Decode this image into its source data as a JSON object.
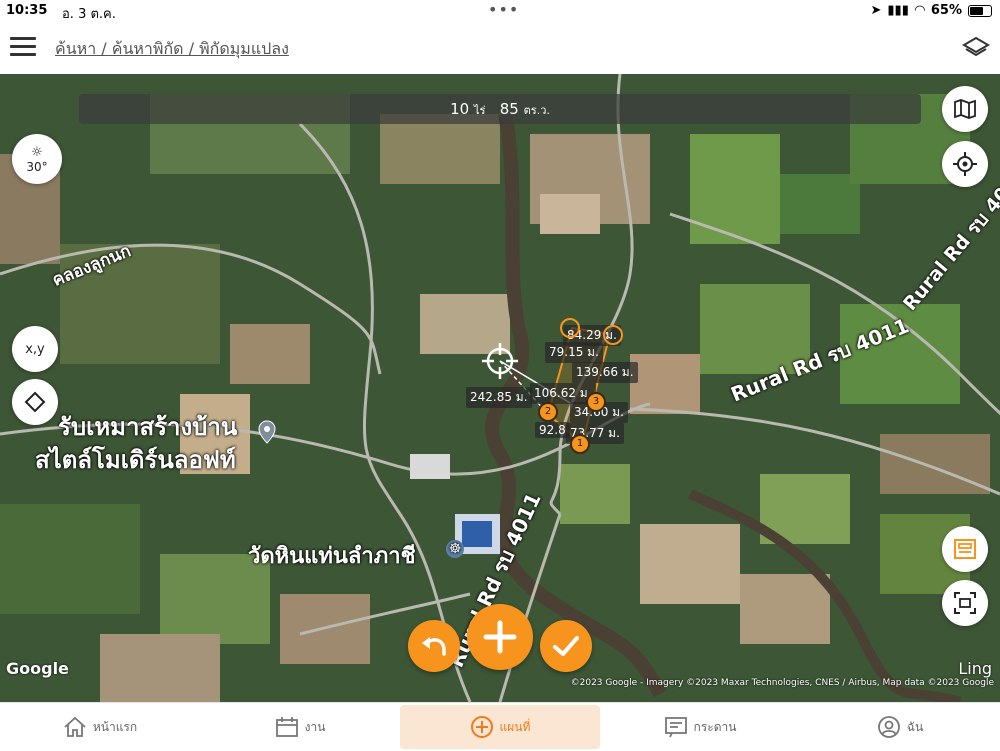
{
  "status_bar": {
    "time": "10:35",
    "date": "อ. 3 ต.ค.",
    "battery": "65%"
  },
  "header": {
    "breadcrumb": "ค้นหา / ค้นหาพิกัด / พิกัดมุมแปลง"
  },
  "area": {
    "rai_value": "10",
    "rai_unit": "ไร่",
    "wa_value": "85",
    "wa_unit": "ตร.ว."
  },
  "map_controls": {
    "angle": "30°",
    "xy": "x,y"
  },
  "map_labels": {
    "canal": "คลองลูกนก",
    "business_line1": "รับเหมาสร้างบ้าน",
    "business_line2": "สไตล์โมเดิร์นลอฟท์",
    "temple": "วัดหินแท่นลำภาชี",
    "road_east": "Rural Rd รบ 4011",
    "road_ne": "Rural Rd รบ 40",
    "road_south": "Rural Rd รบ 4011"
  },
  "measurements": [
    "84.29 ม.",
    "79.15 ม.",
    "139.66 ม.",
    "242.85 ม.",
    "106.62 ม.",
    "34.60 ม.",
    "92.8",
    "73.77 ม."
  ],
  "vertices": [
    "1",
    "2",
    "3"
  ],
  "attribution": {
    "google": "Google",
    "ling": "Ling",
    "copyright": "©2023 Google - Imagery ©2023 Maxar Technologies, CNES / Airbus, Map data ©2023 Google"
  },
  "tabs": [
    {
      "label": "หน้าแรก",
      "icon": "home-icon"
    },
    {
      "label": "งาน",
      "icon": "calendar-icon"
    },
    {
      "label": "แผนที่",
      "icon": "plus-circle-icon"
    },
    {
      "label": "กระดาน",
      "icon": "board-icon"
    },
    {
      "label": "ฉัน",
      "icon": "user-icon"
    }
  ],
  "colors": {
    "accent": "#f7941d",
    "active_tab_bg": "#fbe6d3"
  }
}
